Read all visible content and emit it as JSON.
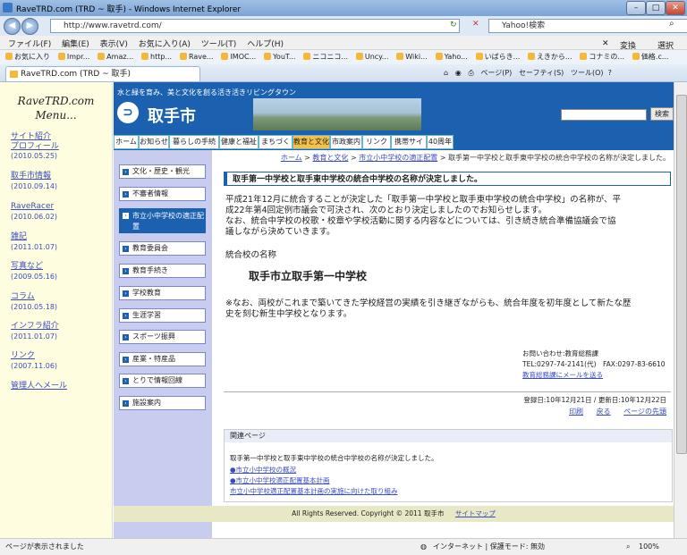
{
  "window": {
    "title": "RaveTRD.com (TRD ~ 取手) - Windows Internet Explorer"
  },
  "address": {
    "url": "http://www.ravetrd.com/",
    "search_placeholder": "Yahoo!検索"
  },
  "menu": [
    "ファイル(F)",
    "編集(E)",
    "表示(V)",
    "お気に入り(A)",
    "ツール(T)",
    "ヘルプ(H)"
  ],
  "menu_right": [
    "変換",
    "選択"
  ],
  "favorites": [
    "お気に入り",
    "Impr...",
    "Amaz...",
    "http...",
    "Rave...",
    "IMOC...",
    "YouT...",
    "ニコニコ...",
    "Uncy...",
    "Wiki...",
    "Yaho...",
    "いばらき...",
    "えきから...",
    "コナミの...",
    "価格.c..."
  ],
  "tab": {
    "label": "RaveTRD.com (TRD ~ 取手)"
  },
  "tab_tools": [
    "ページ(P)",
    "セーフティ(S)",
    "ツール(O)"
  ],
  "sidebar": {
    "title_line1": "RaveTRD.com",
    "title_line2": "Menu...",
    "items": [
      {
        "label": "サイト紹介",
        "label2": "プロフィール",
        "date": "(2010.05.25)"
      },
      {
        "label": "取手市情報",
        "date": "(2010.09.14)"
      },
      {
        "label": "RaveRacer",
        "date": "(2010.06.02)"
      },
      {
        "label": "雑記",
        "date": "(2011.01.07)"
      },
      {
        "label": "写真など",
        "date": "(2009.05.16)"
      },
      {
        "label": "コラム",
        "date": "(2010.05.18)"
      },
      {
        "label": "インフラ紹介",
        "date": "(2011.01.07)"
      },
      {
        "label": "リンク",
        "date": "(2007.11.06)"
      },
      {
        "label": "管理人へメール"
      }
    ]
  },
  "banner": {
    "tagline": "水と緑を育み、美と文化を創る活き活きリビングタウン",
    "logo": "⊃",
    "city": "取手市",
    "search_button": "検索"
  },
  "gnav": [
    "ホーム",
    "お知らせ",
    "暮らしの手続き",
    "健康と福祉",
    "まちづくり",
    "教育と文化",
    "市政案内",
    "リンク集",
    "携帯サイト",
    "40周年"
  ],
  "lnav": [
    "文化・歴史・観光",
    "不審者情報",
    "市立小中学校の適正配置",
    "教育委員会",
    "教育手続き",
    "学校教育",
    "生涯学習",
    "スポーツ振興",
    "産業・特産品",
    "とりで情報回線",
    "施設案内"
  ],
  "breadcrumb": {
    "home": "ホーム",
    "b1": "教育と文化",
    "b2": "市立小中学校の適正配置",
    "current": "取手第一中学校と取手東中学校の統合中学校の名称が決定しました。"
  },
  "article": {
    "heading": "取手第一中学校と取手東中学校の統合中学校の名称が決定しました。",
    "p1a": "平成21年12月に統合することが決定した「取手第一中学校と取手東中学校の統合中学校」の名称が、平",
    "p1b": "成22年第4回定例市議会で可決され、次のとおり決定しましたのでお知らせします。",
    "p2a": "なお、統合中学校の校歌・校章や学校活動に関する内容などについては、引き続き統合準備協議会で協",
    "p2b": "議しながら決めていきます。",
    "name_label": "統合校の名称",
    "school": "取手市立取手第一中学校",
    "p3a": "※なお、両校がこれまで築いてきた学校経営の実績を引き継ぎながらも、統合年度を初年度として新たな歴",
    "p3b": "史を刻む新生中学校となります。",
    "contact1": "お問い合わせ:教育総務課",
    "contact2": "TEL:0297-74-2141(代)　FAX:0297-83-6610",
    "contact3": "教育総務課にメールを送る",
    "dates": "登録日:10年12月21日 / 更新日:10年12月22日",
    "tools": [
      "印刷",
      "戻る",
      "ページの先頭"
    ]
  },
  "related": {
    "title": "関連ページ",
    "text": "取手第一中学校と取手東中学校の統合中学校の名称が決定しました。",
    "links": [
      "●市立小中学校の概況",
      "●市立小中学校適正配置基本計画",
      "市立小中学校適正配置基本計画の実施に向けた取り組み"
    ]
  },
  "footer": {
    "copyright": "All Rights Reserved. Copyright © 2011 取手市",
    "sitemap": "サイトマップ"
  },
  "status": {
    "left": "ページが表示されました",
    "zone": "インターネット | 保護モード: 無効",
    "zoom": "100%"
  }
}
